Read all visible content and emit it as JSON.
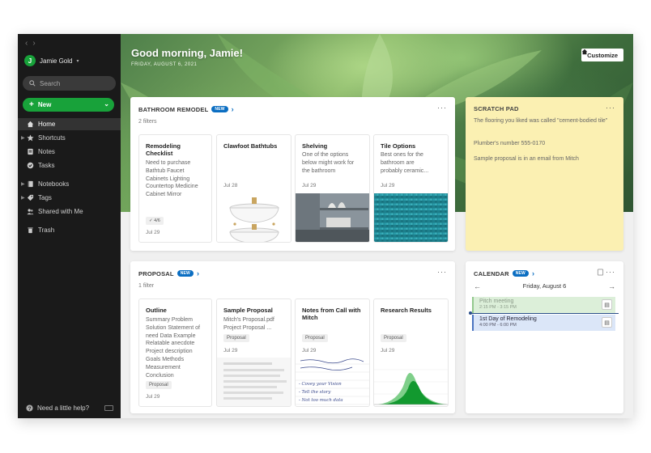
{
  "sidebar": {
    "nav_back": "‹",
    "nav_forward": "›",
    "user": {
      "initial": "J",
      "name": "Jamie Gold"
    },
    "search_placeholder": "Search",
    "new_label": "New",
    "items": [
      {
        "label": "Home",
        "icon": "home-icon",
        "active": true
      },
      {
        "label": "Shortcuts",
        "icon": "star-icon"
      },
      {
        "label": "Notes",
        "icon": "note-icon"
      },
      {
        "label": "Tasks",
        "icon": "check-circle-icon"
      },
      {
        "label": "Notebooks",
        "icon": "notebook-icon"
      },
      {
        "label": "Tags",
        "icon": "tag-icon"
      },
      {
        "label": "Shared with Me",
        "icon": "people-icon"
      },
      {
        "label": "Trash",
        "icon": "trash-icon"
      }
    ],
    "help_label": "Need a little help?"
  },
  "header": {
    "greeting": "Good morning, Jamie!",
    "date": "FRIDAY, AUGUST 6, 2021",
    "customize_label": "Customize"
  },
  "bathroom": {
    "title": "BATHROOM REMODEL",
    "badge": "NEW",
    "filters": "2 filters",
    "cards": [
      {
        "title": "Remodeling Checklist",
        "text": [
          "Need to purchase",
          "Bathtub Faucet",
          "Cabinets Lighting",
          "Countertop Medicine",
          "Cabinet Mirror"
        ],
        "chip": "4/6",
        "date": "Jul 29"
      },
      {
        "title": "Clawfoot Bathtubs",
        "date": "Jul 28"
      },
      {
        "title": "Shelving",
        "text": [
          "One of the options",
          "below might work for",
          "the bathroom"
        ],
        "date": "Jul 29"
      },
      {
        "title": "Tile Options",
        "text": [
          "Best ones for the",
          "bathroom are",
          "probably ceramic..."
        ],
        "date": "Jul 29"
      }
    ]
  },
  "scratch": {
    "title": "SCRATCH PAD",
    "lines": [
      "The flooring you liked was called \"cement-bodied tile\"",
      "Plumber's number 555-0170",
      "Sample proposal is in an email from Mitch"
    ]
  },
  "proposal": {
    "title": "PROPOSAL",
    "badge": "NEW",
    "filters": "1 filter",
    "cards": [
      {
        "title": "Outline",
        "text": [
          "Summary Problem",
          "Solution Statement of",
          "need Data Example",
          "Relatable anecdote",
          "Project description",
          "Goals Methods",
          "Measurement",
          "Conclusion"
        ],
        "tag": "Proposal",
        "date": "Jul 29"
      },
      {
        "title": "Sample Proposal",
        "text": [
          "Mitch's Proposal.pdf",
          "Project Proposal ..."
        ],
        "tag": "Proposal",
        "date": "Jul 29"
      },
      {
        "title": "Notes from Call with Mitch",
        "tag": "Proposal",
        "date": "Jul 29",
        "handwriting": [
          "- Covey your Vision",
          "- Tell the story",
          "- Not too much data"
        ]
      },
      {
        "title": "Research Results",
        "tag": "Proposal",
        "date": "Jul 29"
      }
    ]
  },
  "calendar": {
    "title": "CALENDAR",
    "badge": "NEW",
    "day": "Friday, August 6",
    "events": [
      {
        "title": "Pitch meeting",
        "time": "2:15 PM - 3:15 PM"
      },
      {
        "title": "1st Day of Remodeling",
        "time": "4:00 PM - 6:00 PM"
      }
    ]
  },
  "colors": {
    "accent_green": "#18a23a",
    "accent_blue": "#0b6ec2",
    "sidebar": "#1a1a1a",
    "scratch": "#fbf0b2"
  }
}
